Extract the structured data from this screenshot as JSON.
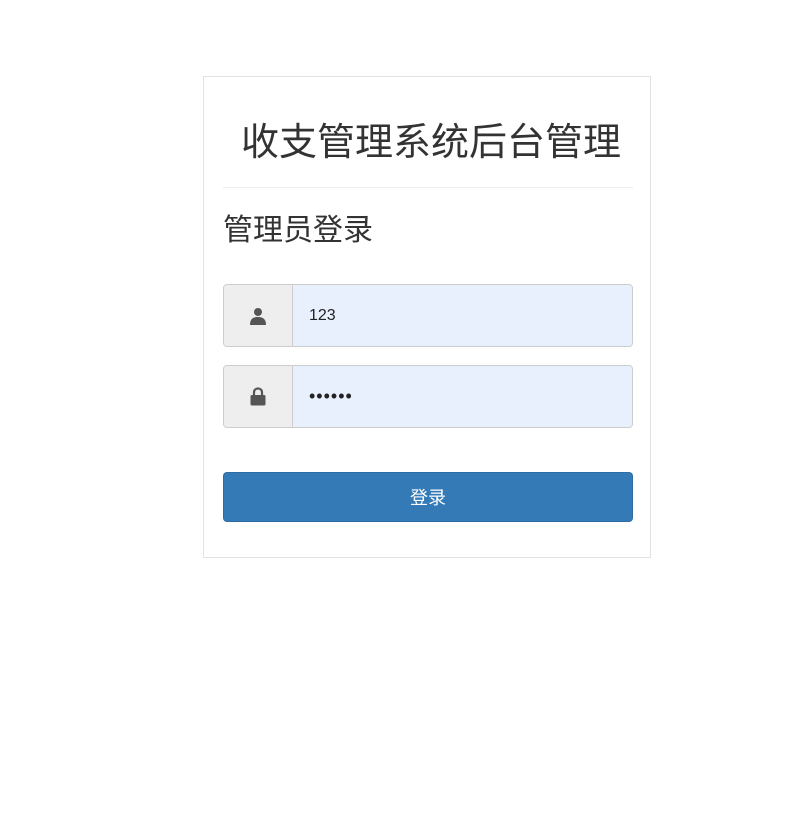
{
  "app": {
    "title": "收支管理系统后台管理"
  },
  "login": {
    "heading": "管理员登录",
    "username": {
      "icon": "user-icon",
      "value": "123"
    },
    "password": {
      "icon": "lock-icon",
      "value": "••••••"
    },
    "submit_label": "登录"
  },
  "colors": {
    "primary": "#337ab7",
    "input_autofill_bg": "#e8f0fe",
    "addon_bg": "#eeeeee",
    "icon": "#555555"
  }
}
